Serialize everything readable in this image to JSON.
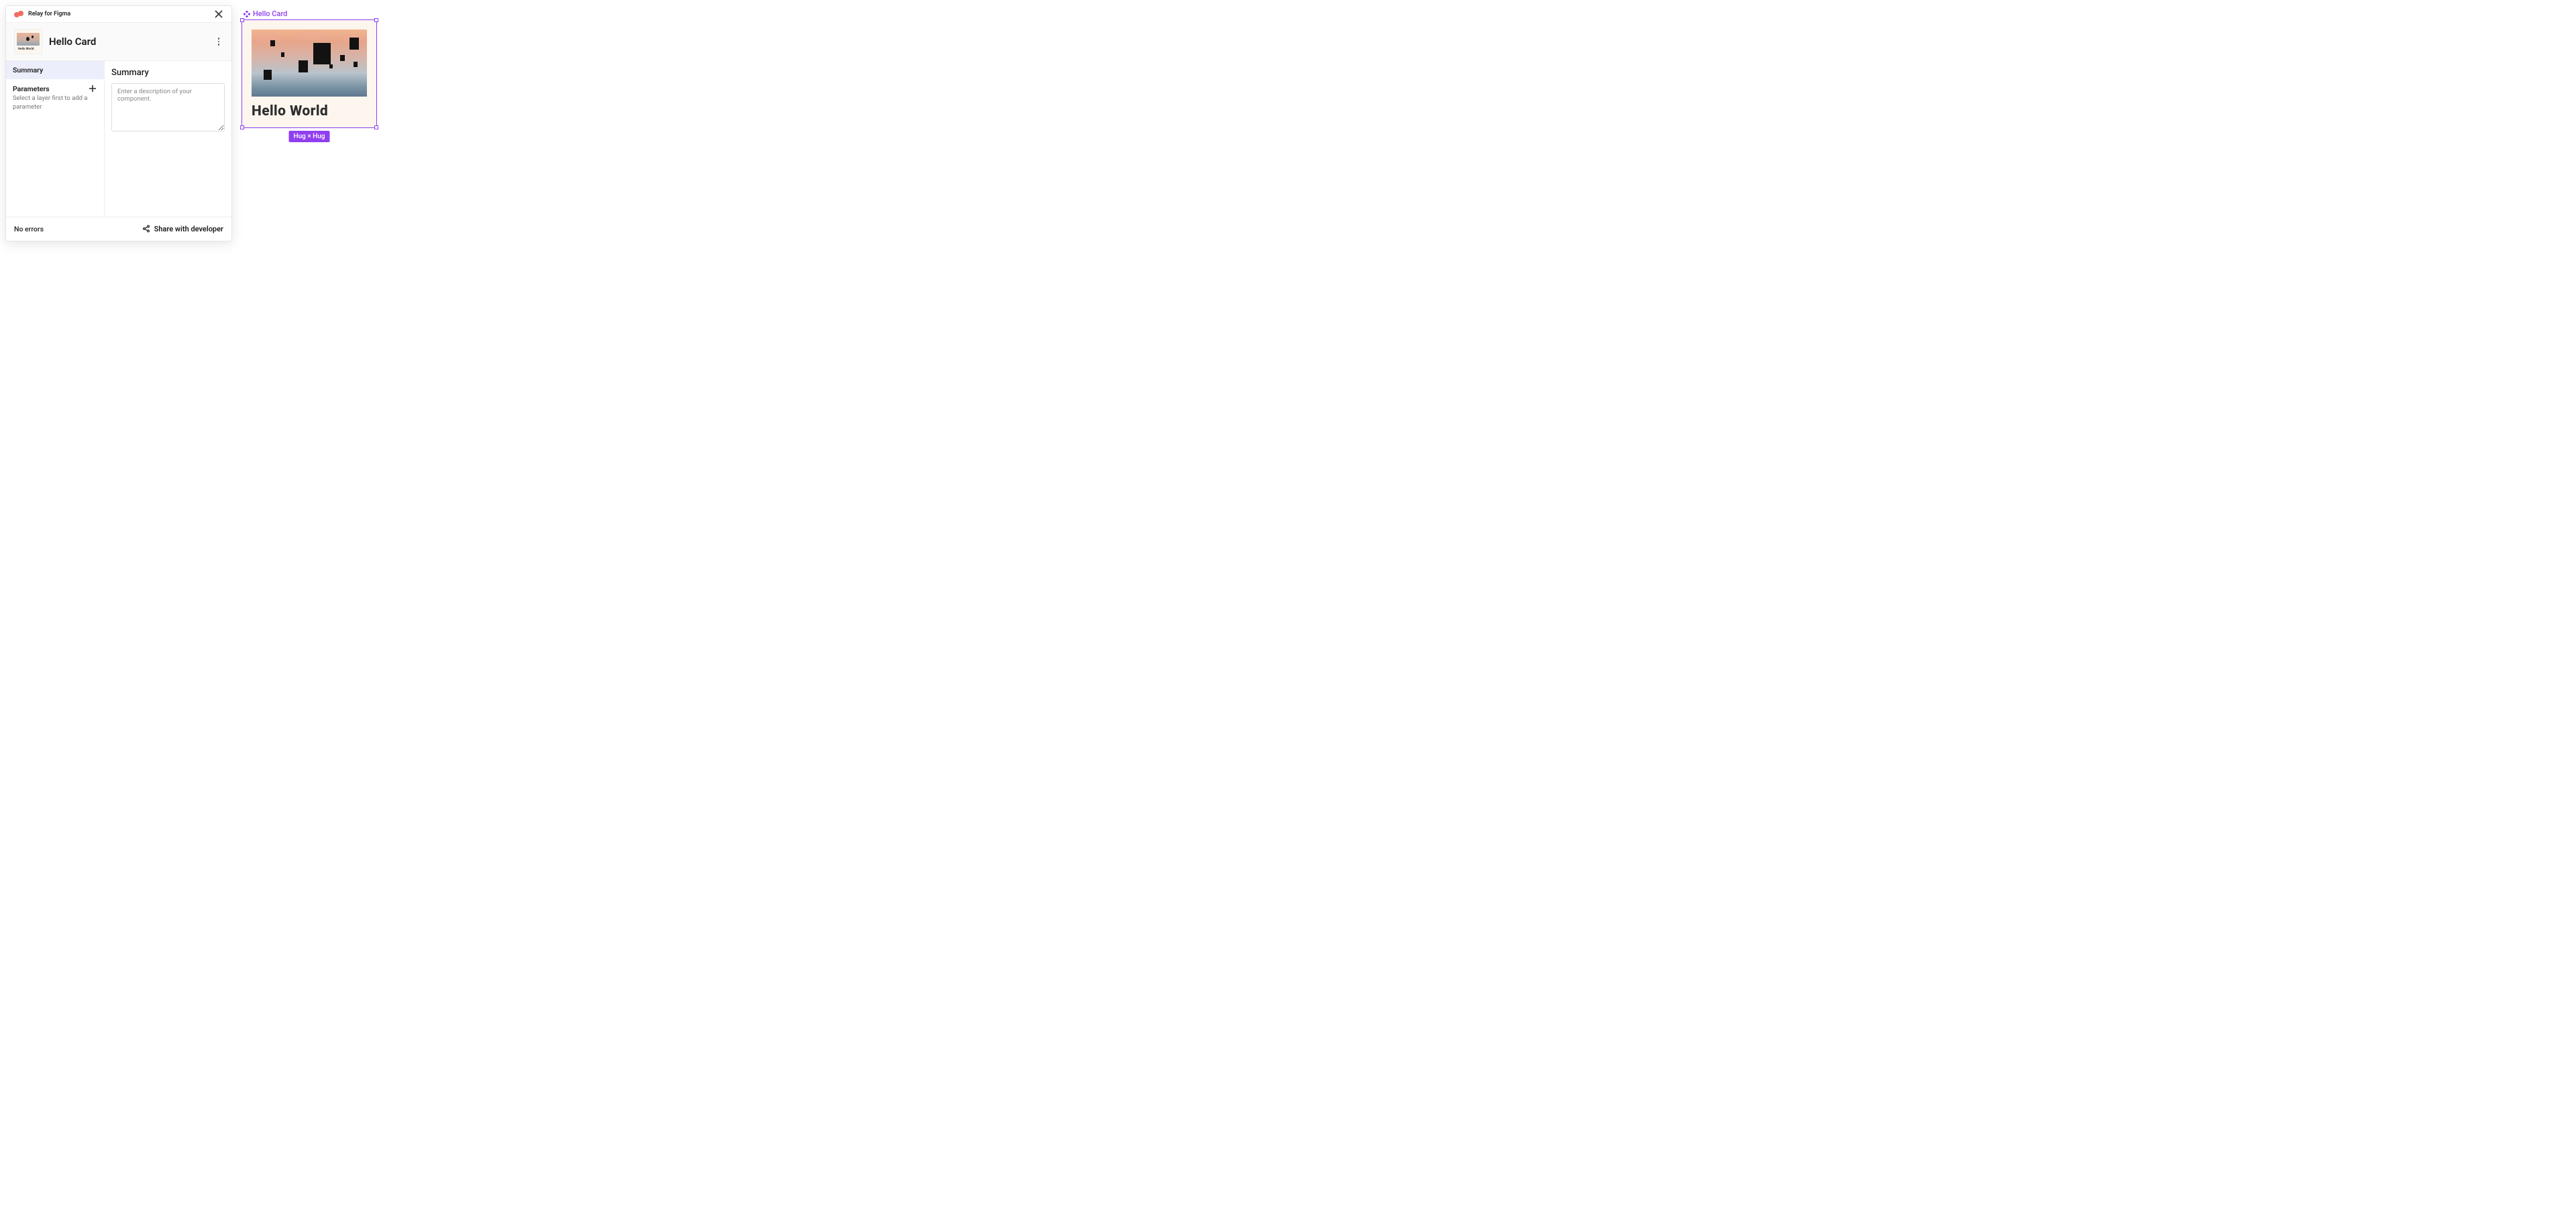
{
  "plugin": {
    "title": "Relay for Figma"
  },
  "header": {
    "component_name": "Hello Card",
    "thumbnail_text": "Hello World"
  },
  "tabs": {
    "summary": "Summary"
  },
  "parameters": {
    "label": "Parameters",
    "hint": "Select a layer first to add a parameter"
  },
  "right": {
    "title": "Summary",
    "placeholder": "Enter a description of your component."
  },
  "footer": {
    "status": "No errors",
    "share_label": "Share with developer"
  },
  "canvas": {
    "component_label": "Hello Card",
    "card_text": "Hello World",
    "constraint_badge": "Hug × Hug"
  },
  "colors": {
    "selection": "#8f3ff0",
    "card_bg": "#fdf6ef",
    "logo": "#ef6e64"
  }
}
